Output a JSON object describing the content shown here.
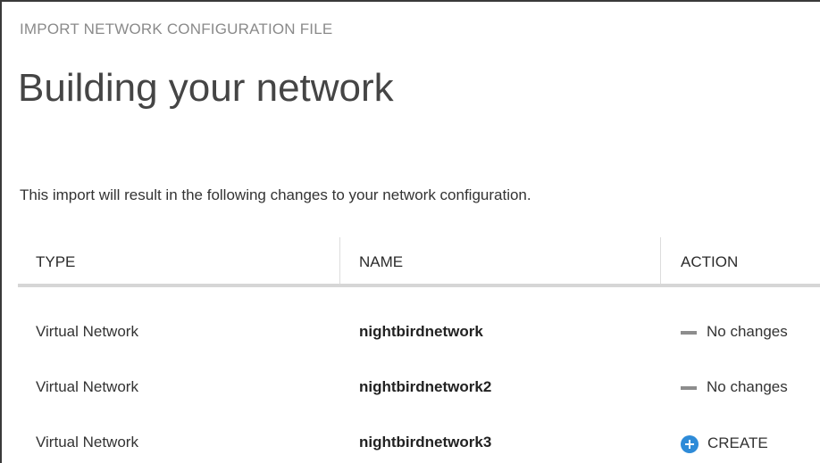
{
  "dialog": {
    "kicker": "IMPORT NETWORK CONFIGURATION FILE",
    "title": "Building your network",
    "intro": "This import will result in the following changes to your network configuration."
  },
  "table": {
    "columns": [
      "TYPE",
      "NAME",
      "ACTION"
    ],
    "rows": [
      {
        "type": "Virtual Network",
        "name": "nightbirdnetwork",
        "action": "No changes",
        "action_icon": "dash-icon"
      },
      {
        "type": "Virtual Network",
        "name": "nightbirdnetwork2",
        "action": "No changes",
        "action_icon": "dash-icon"
      },
      {
        "type": "Virtual Network",
        "name": "nightbirdnetwork3",
        "action": "CREATE",
        "action_icon": "plus-circle-icon"
      }
    ]
  },
  "colors": {
    "accent": "#2e8bd8",
    "header_rule": "#d6d6d6",
    "kicker": "#8a8a8a"
  }
}
